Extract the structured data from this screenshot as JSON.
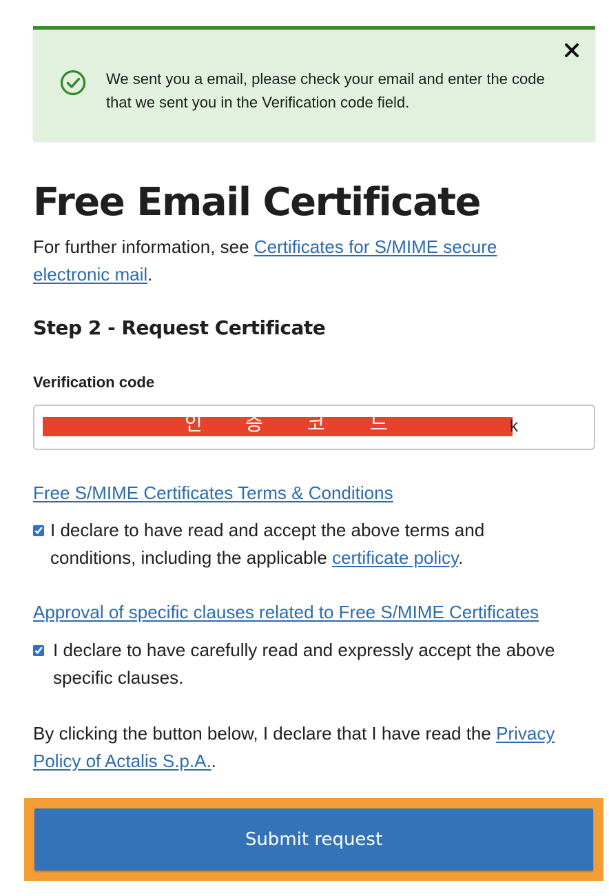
{
  "alert": {
    "message": "We sent you a email, please check your email and enter the code that we sent you in the Verification code field.",
    "icon": "check-circle-icon",
    "close_icon": "close-icon",
    "accent_color": "#3a8b29",
    "background_color": "#e2f0de"
  },
  "page": {
    "title": "Free Email Certificate",
    "intro_prefix": "For further information, see ",
    "intro_link": "Certificates for S/MIME secure electronic mail",
    "intro_suffix": "."
  },
  "step": {
    "title": "Step 2 - Request Certificate"
  },
  "verification": {
    "label": "Verification code",
    "redaction_note": [
      "인",
      "증",
      "코",
      "드"
    ],
    "visible_tail": "k",
    "redaction_color": "#e8412c"
  },
  "terms": {
    "link": "Free S/MIME Certificates Terms & Conditions",
    "checkbox_prefix": "I declare to have read and accept the above terms and conditions, including the applicable ",
    "checkbox_link": "certificate policy",
    "checkbox_suffix": ".",
    "checked": true
  },
  "clauses": {
    "link": "Approval of specific clauses related to Free S/MIME Certificates",
    "checkbox_text": "I declare to have carefully read and expressly accept the above specific clauses.",
    "checked": true
  },
  "privacy": {
    "prefix": "By clicking the button below, I declare that I have read the ",
    "link": "Privacy Policy of Actalis S.p.A.",
    "suffix": "."
  },
  "submit": {
    "label": "Submit request",
    "color": "#3573b9",
    "highlight_color": "#f39d37"
  }
}
